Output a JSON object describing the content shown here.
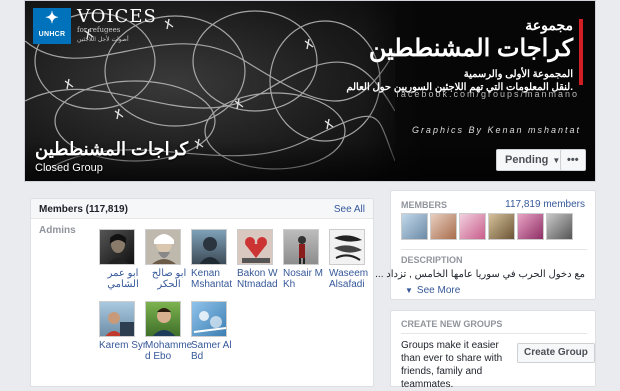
{
  "cover": {
    "unhcr_logo": "UNHCR",
    "voices_title": "VOICES",
    "voices_sub": "for refugees",
    "voices_arabic": "أصوات لأجل اللاجئين",
    "brand_line1": "مجموعة",
    "brand_line2": "كراجات المشنططين",
    "brand_line3": "المجموعة الأولى والرسمية",
    "brand_line4": "لنقل المعلومات التي تهم اللاجئين السوريين حول العالم.",
    "fb_url": "facebook.com/groups/manmano",
    "credit": "Graphics By Kenan mshantat",
    "group_name": "كراجات المشنططين",
    "group_type": "Closed Group",
    "pending_label": "Pending",
    "more_label": "•••",
    "accent_red": "#d21f26"
  },
  "members_panel": {
    "title": "Members (117,819)",
    "see_all": "See All",
    "admins_label": "Admins",
    "admins": [
      {
        "name_l1": "ابو عمر",
        "name_l2": "الشامي",
        "arabic": true,
        "icon": "portrait-photo"
      },
      {
        "name_l1": "ابو صالح",
        "name_l2": "الحكر",
        "arabic": true,
        "icon": "portrait-photo"
      },
      {
        "name_l1": "Kenan",
        "name_l2": "Mshantat",
        "arabic": false,
        "icon": "portrait-photo"
      },
      {
        "name_l1": "Bakon W",
        "name_l2": "Ntmadad",
        "arabic": false,
        "icon": "portrait-photo"
      },
      {
        "name_l1": "Nosair M",
        "name_l2": "Kh",
        "arabic": false,
        "icon": "portrait-photo"
      },
      {
        "name_l1": "Waseem",
        "name_l2": "Alsafadi",
        "arabic": false,
        "icon": "portrait-photo"
      },
      {
        "name_l1": "Karem Syr",
        "name_l2": "",
        "arabic": false,
        "icon": "portrait-photo"
      },
      {
        "name_l1": "Mohamme",
        "name_l2": "d Ebo",
        "arabic": false,
        "icon": "portrait-photo"
      },
      {
        "name_l1": "Samer Al",
        "name_l2": "Bd",
        "arabic": false,
        "icon": "portrait-photo"
      }
    ]
  },
  "members_side": {
    "label": "MEMBERS",
    "count": "117,819 members",
    "description_label": "DESCRIPTION",
    "description": "مع دخول الحرب في سوريا عامها الخامس , تزداد ...",
    "see_more": "See More"
  },
  "create_groups": {
    "label": "CREATE NEW GROUPS",
    "text": "Groups make it easier than ever to share with friends, family and teammates.",
    "button": "Create Group"
  }
}
